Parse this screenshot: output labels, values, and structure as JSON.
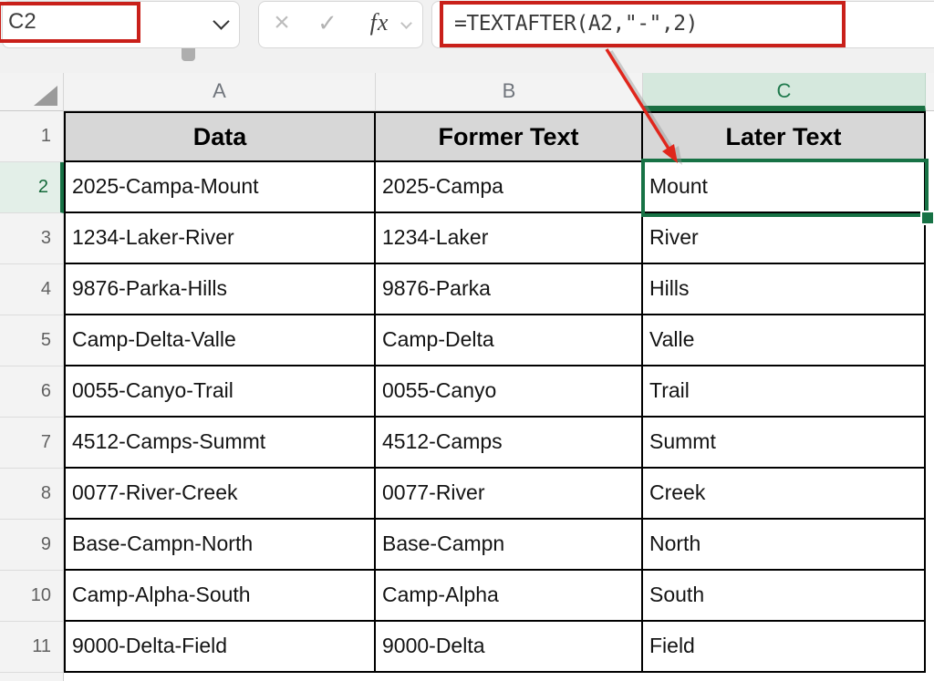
{
  "name_box": {
    "value": "C2"
  },
  "formula_bar": {
    "formula": "=TEXTAFTER(A2,\"-\",2)",
    "cancel": "×",
    "enter": "✓",
    "fx": "fx"
  },
  "columns": {
    "a": "A",
    "b": "B",
    "c": "C"
  },
  "header_row": {
    "num": "1",
    "a": "Data",
    "b": "Former Text",
    "c": "Later Text"
  },
  "rows": [
    {
      "num": "2",
      "a": "2025-Campa-Mount",
      "b": "2025-Campa",
      "c": "Mount"
    },
    {
      "num": "3",
      "a": "1234-Laker-River",
      "b": "1234-Laker",
      "c": "River"
    },
    {
      "num": "4",
      "a": "9876-Parka-Hills",
      "b": "9876-Parka",
      "c": "Hills"
    },
    {
      "num": "5",
      "a": "Camp-Delta-Valle",
      "b": "Camp-Delta",
      "c": "Valle"
    },
    {
      "num": "6",
      "a": "0055-Canyo-Trail",
      "b": "0055-Canyo",
      "c": "Trail"
    },
    {
      "num": "7",
      "a": "4512-Camps-Summt",
      "b": "4512-Camps",
      "c": "Summt"
    },
    {
      "num": "8",
      "a": "0077-River-Creek",
      "b": "0077-River",
      "c": "Creek"
    },
    {
      "num": "9",
      "a": "Base-Campn-North",
      "b": "Base-Campn",
      "c": "North"
    },
    {
      "num": "10",
      "a": "Camp-Alpha-South",
      "b": "Camp-Alpha",
      "c": "South"
    },
    {
      "num": "11",
      "a": "9000-Delta-Field",
      "b": "9000-Delta",
      "c": "Field"
    }
  ],
  "selection": {
    "cell": "C2",
    "column": "C",
    "row": "2"
  },
  "colors": {
    "annotation_red": "#c9201a",
    "arrow_red": "#e0261c",
    "selection_green": "#177245",
    "column_header_green_fill": "#d5e8dd",
    "table_header_fill": "#d7d7d7"
  }
}
